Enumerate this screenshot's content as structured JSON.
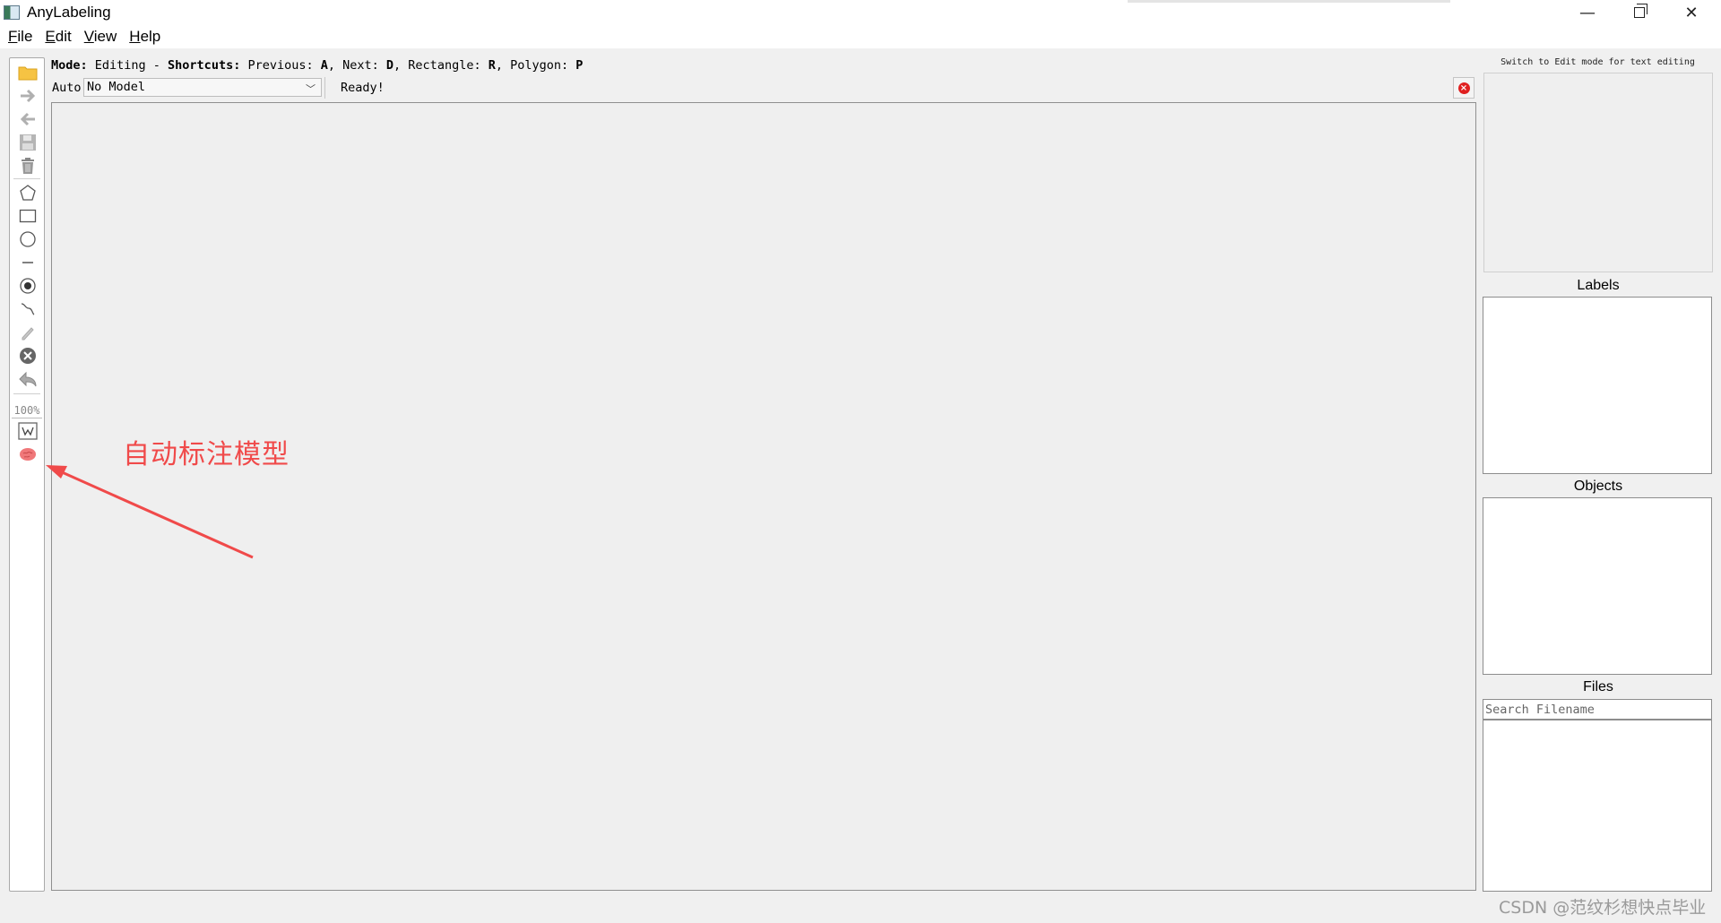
{
  "window": {
    "title": "AnyLabeling",
    "controls": {
      "minimize": "—",
      "close": "✕"
    }
  },
  "menu": {
    "items": [
      {
        "mnemonic": "F",
        "rest": "ile"
      },
      {
        "mnemonic": "E",
        "rest": "dit"
      },
      {
        "mnemonic": "V",
        "rest": "iew"
      },
      {
        "mnemonic": "H",
        "rest": "elp"
      }
    ]
  },
  "mode_line": {
    "mode_key": "Mode:",
    "mode_value": " Editing - ",
    "shortcuts_key": "Shortcuts:",
    "shortcuts_value": " Previous: ",
    "prev_key": "A",
    "next_label": ", Next: ",
    "next_key": "D",
    "rect_label": ", Rectangle: ",
    "rect_key": "R",
    "poly_label": ", Polygon: ",
    "poly_key": "P"
  },
  "auto": {
    "label": "Auto",
    "model_selected": "No Model"
  },
  "status": {
    "text": "Ready!"
  },
  "toolbar": {
    "zoom": "100%",
    "tools": [
      "open-folder",
      "next",
      "prev",
      "save",
      "delete",
      "polygon",
      "rectangle",
      "circle",
      "line",
      "point",
      "linestrip",
      "edit",
      "delete-shape",
      "undo",
      "fit-window",
      "auto-labeling-brain"
    ]
  },
  "annotation": {
    "text": "自动标注模型",
    "color": "#f04a4a"
  },
  "right_panel": {
    "hint": "Switch to Edit mode for text editing",
    "labels_title": "Labels",
    "objects_title": "Objects",
    "files_title": "Files",
    "search_placeholder": "Search Filename"
  },
  "watermark": "CSDN @范纹杉想快点毕业"
}
